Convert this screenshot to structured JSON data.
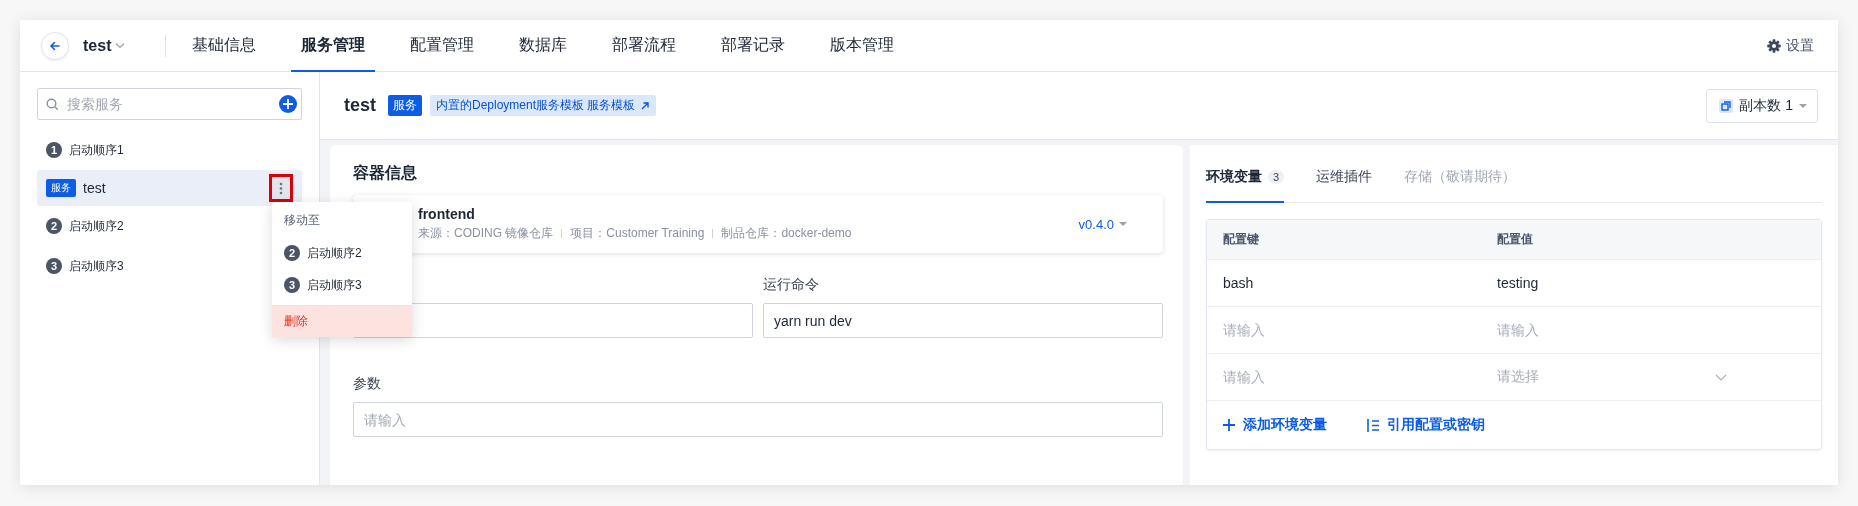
{
  "nav": {
    "project": "test",
    "tabs": [
      {
        "label": "基础信息",
        "selected": false
      },
      {
        "label": "服务管理",
        "selected": true
      },
      {
        "label": "配置管理",
        "selected": false
      },
      {
        "label": "数据库",
        "selected": false
      },
      {
        "label": "部署流程",
        "selected": false
      },
      {
        "label": "部署记录",
        "selected": false
      },
      {
        "label": "版本管理",
        "selected": false
      }
    ],
    "settings": "设置"
  },
  "sidebar": {
    "search": {
      "placeholder": "搜索服务"
    },
    "items": [
      {
        "kind": "stage",
        "number": "1",
        "label": "启动顺序1",
        "selected": false
      },
      {
        "kind": "service",
        "badge": "服务",
        "label": "test",
        "selected": true,
        "menu_open": true
      },
      {
        "kind": "stage",
        "number": "2",
        "label": "启动顺序2",
        "selected": false
      },
      {
        "kind": "stage",
        "number": "3",
        "label": "启动顺序3",
        "selected": false
      }
    ],
    "menu": {
      "title": "移动至",
      "items": [
        {
          "kind": "stage",
          "number": "2",
          "label": "启动顺序2",
          "selected": false
        },
        {
          "kind": "stage",
          "number": "3",
          "label": "启动顺序3",
          "selected": false
        },
        {
          "kind": "danger",
          "label": "删除",
          "selected": true
        }
      ]
    }
  },
  "header": {
    "title": "test",
    "badge": "服务",
    "template_link": "内置的Deployment服务模板 服务模板",
    "replicas": "副本数 1"
  },
  "container": {
    "title": "容器信息",
    "image": {
      "name": "frontend",
      "meta": [
        "来源：CODING 镜像仓库",
        "项目：Customer Training",
        "制品仓库：docker-demo"
      ],
      "version": "v0.4.0"
    },
    "fields": [
      {
        "kind": "covered"
      },
      {
        "kind": "half",
        "label": "运行命令",
        "value": "yarn run dev"
      },
      {
        "kind": "wide",
        "label": "参数",
        "placeholder": "请输入"
      }
    ]
  },
  "env": {
    "tabs": [
      {
        "label": "环境变量",
        "count": "3",
        "selected": true,
        "disabled": false
      },
      {
        "label": "运维插件",
        "selected": false,
        "disabled": false
      },
      {
        "label": "存储（敬请期待）",
        "selected": false,
        "disabled": true
      }
    ],
    "columns": [
      "配置键",
      "配置值"
    ],
    "rows": [
      {
        "cells": [
          {
            "kind": "text",
            "text": "bash"
          },
          {
            "kind": "text",
            "text": "testing"
          }
        ]
      },
      {
        "cells": [
          {
            "kind": "input",
            "placeholder": "请输入"
          },
          {
            "kind": "input",
            "placeholder": "请输入"
          }
        ]
      },
      {
        "cells": [
          {
            "kind": "input",
            "placeholder": "请输入"
          },
          {
            "kind": "select",
            "placeholder": "请选择"
          }
        ]
      }
    ],
    "actions": [
      {
        "kind": "add",
        "label": "添加环境变量"
      },
      {
        "kind": "reference",
        "label": "引用配置或密钥"
      }
    ]
  }
}
